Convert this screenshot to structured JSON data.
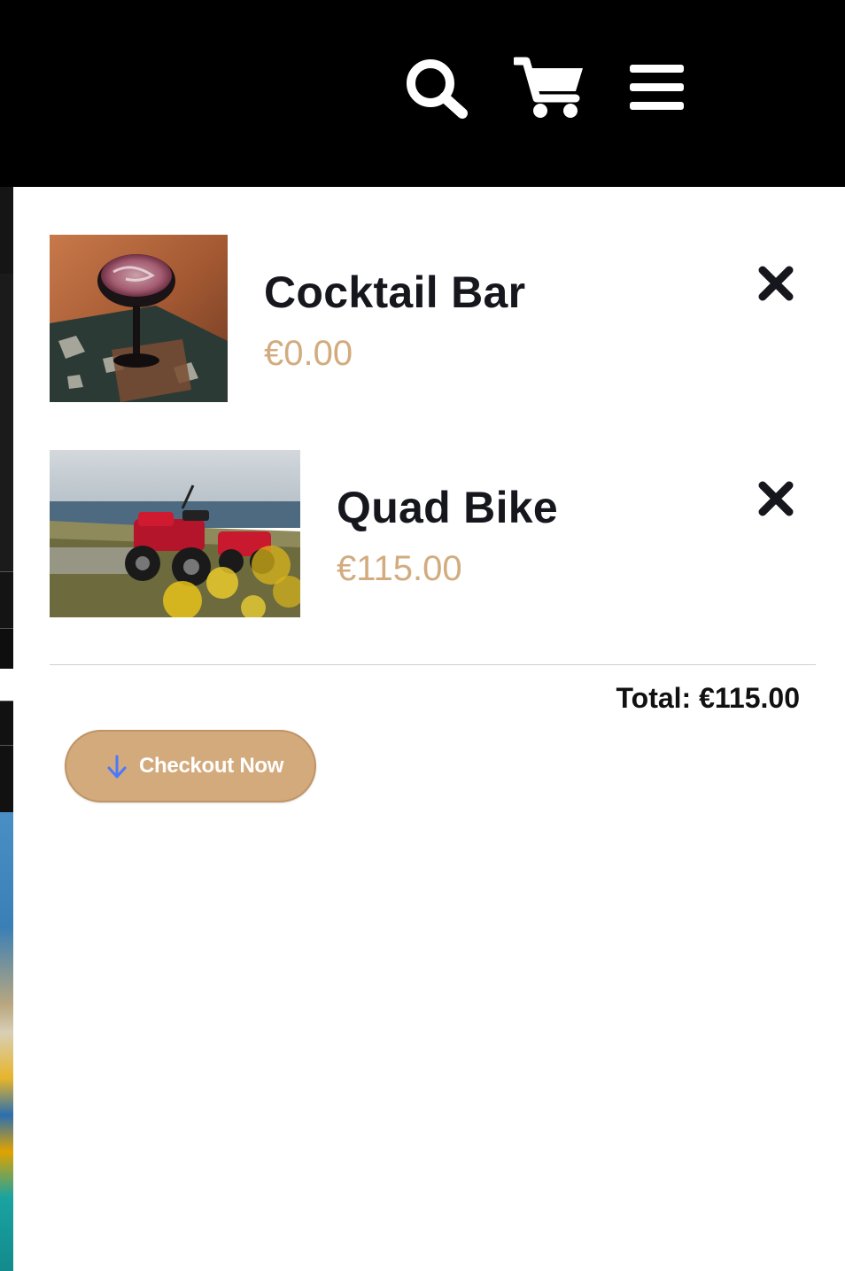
{
  "header": {
    "icons": [
      "search-icon",
      "cart-icon",
      "hamburger-menu-icon"
    ]
  },
  "cart": {
    "items": [
      {
        "name": "Cocktail Bar",
        "price": "€0.00",
        "image": "cocktail-glass-photo"
      },
      {
        "name": "Quad Bike",
        "price": "€115.00",
        "image": "quad-bike-photo"
      }
    ],
    "remove_icon": "close-icon",
    "total_label": "Total: €115.00",
    "checkout_label": "Checkout Now",
    "checkout_icon": "arrow-down-icon"
  },
  "colors": {
    "header_bg": "#000000",
    "price": "#d2ac7f",
    "checkout_bg": "#d3aa7c",
    "checkout_arrow": "#4a78ff"
  }
}
